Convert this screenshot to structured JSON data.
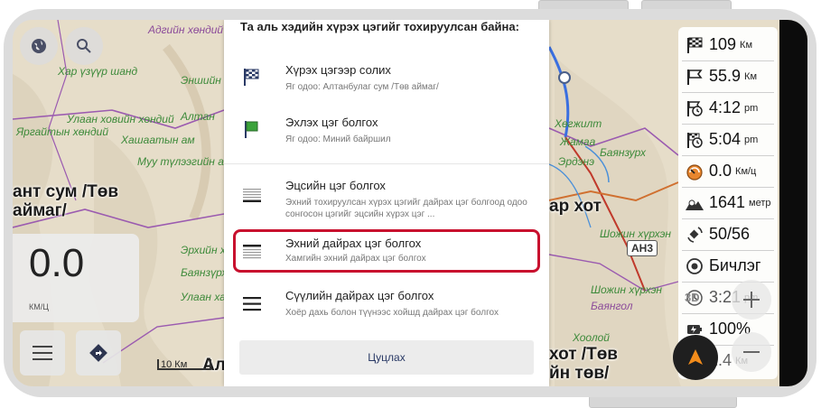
{
  "dialog": {
    "title": "Та аль хэдийн хүрэх цэгийг тохируулсан байна:",
    "items": [
      {
        "title": "Хүрэх цэгээр солих",
        "subtitle": "Яг одоо: Алтанбулаг сум /Төв аймаг/",
        "icon": "checkered-flag-icon"
      },
      {
        "title": "Эхлэх цэг болгох",
        "subtitle": "Яг одоо: Миний байршил",
        "icon": "green-flag-icon"
      },
      {
        "title": "Эцсийн цэг болгох",
        "subtitle": "Эхний тохируулсан хүрэх цэгийг дайрах цэг болгоод одоо сонгосон цэгийг эцсийн хүрэх цэг ...",
        "icon": "last-stop-icon"
      },
      {
        "title": "Эхний дайрах цэг болгох",
        "subtitle": "Хамгийн эхний дайрах цэг болгох",
        "icon": "first-stop-icon"
      },
      {
        "title": "Сүүлийн дайрах цэг болгох",
        "subtitle": "Хоёр дахь болон түүнээс хойшд дайрах цэг болгох",
        "icon": "last-intermediate-icon"
      }
    ],
    "cancel_label": "Цуцлах"
  },
  "map": {
    "labels": [
      {
        "text": "Хар үзүүр шанд"
      },
      {
        "text": "Эншийн шанд"
      },
      {
        "text": "Улаан ховийн хөндий"
      },
      {
        "text": "Яргайтын хөндий"
      },
      {
        "text": "Хашаатын ам"
      },
      {
        "text": "Муу түлээгийн ам"
      },
      {
        "text": "Улаан хавцал"
      },
      {
        "text": "Баянзүрх"
      },
      {
        "text": "Шожин хүрхэн"
      },
      {
        "text": "Баянзурх"
      },
      {
        "text": "Жамаа"
      },
      {
        "text": "Хөгжилт"
      },
      {
        "text": "Шожин хүрхэн"
      },
      {
        "text": "Хоолой"
      },
      {
        "text": "Адгийн хөндий"
      },
      {
        "text": "Баянгол"
      },
      {
        "text": "Эрхийн хөндий"
      },
      {
        "text": "Алтан"
      },
      {
        "text": "Эрдэнэ"
      }
    ],
    "city_left": "ант сум /Төв\nаймаг/",
    "city_right": "ар хот",
    "city_bottom": "хот /Төв\nйн төв/",
    "city_bottom_left": "Ал",
    "road_sign": "АН3",
    "scale_label": "10 Км",
    "speed_value": "0.0",
    "speed_unit": "КМ/Ц"
  },
  "widgets": [
    {
      "icon": "checkered-flag-icon",
      "value": "109",
      "unit": "Км"
    },
    {
      "icon": "flag-icon",
      "value": "55.9",
      "unit": "Км"
    },
    {
      "icon": "arrival-time-icon",
      "value": "4:12",
      "unit": "pm"
    },
    {
      "icon": "finish-time-icon",
      "value": "5:04",
      "unit": "pm"
    },
    {
      "icon": "speedometer-icon",
      "value": "0.0",
      "unit": "Км/ц"
    },
    {
      "icon": "altitude-icon",
      "value": "1641",
      "unit": "метр"
    },
    {
      "icon": "gps-icon",
      "value": "50/56",
      "unit": ""
    },
    {
      "icon": "position-icon",
      "value": "Бичлэг",
      "unit": ""
    },
    {
      "icon": "clock-icon",
      "value": "3:21",
      "unit": "pm"
    },
    {
      "icon": "battery-icon",
      "value": "100%",
      "unit": ""
    },
    {
      "icon": "distance-icon",
      "value": "1.4",
      "unit": "Км"
    }
  ],
  "widget_overlay_badge": "3D",
  "colors": {
    "highlight": "#c8102e",
    "nav_arrow": "#f28c1b",
    "route_purple": "#9b5bb0",
    "route_blue": "#3a6fe0"
  }
}
